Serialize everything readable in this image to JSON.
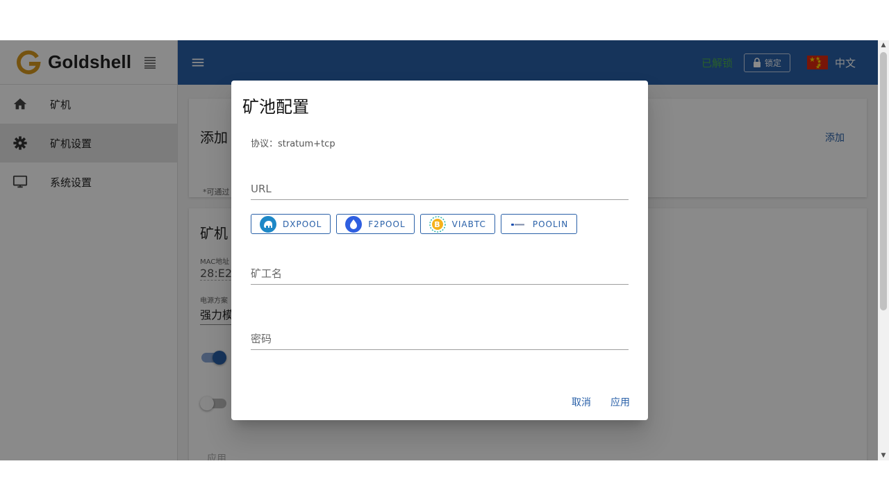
{
  "brand": {
    "name": "Goldshell"
  },
  "sidebar": {
    "items": [
      {
        "label": "矿机",
        "icon": "home-icon"
      },
      {
        "label": "矿机设置",
        "icon": "gear-icon",
        "active": true
      },
      {
        "label": "系统设置",
        "icon": "monitor-icon"
      }
    ]
  },
  "topbar": {
    "unlock_status": "已解锁",
    "lock_label": "锁定",
    "language": "中文"
  },
  "background": {
    "card1_title": "添加",
    "card1_add": "添加",
    "card1_note": "*可通过",
    "card2_title": "矿机",
    "mac_label": "MAC地址",
    "mac_value": "28:E2:",
    "power_label": "电源方案",
    "power_value": "强力模",
    "apply_label": "应用"
  },
  "dialog": {
    "title": "矿池配置",
    "protocol": "协议：stratum+tcp",
    "url_placeholder": "URL",
    "worker_placeholder": "矿工名",
    "password_placeholder": "密码",
    "pools": [
      "DXPOOL",
      "F2POOL",
      "VIABTC",
      "POOLIN"
    ],
    "cancel_label": "取消",
    "apply_label": "应用"
  },
  "colors": {
    "primary": "#2960a8",
    "brand_gold": "#d99a1e",
    "unlock_green": "#4caf50"
  }
}
